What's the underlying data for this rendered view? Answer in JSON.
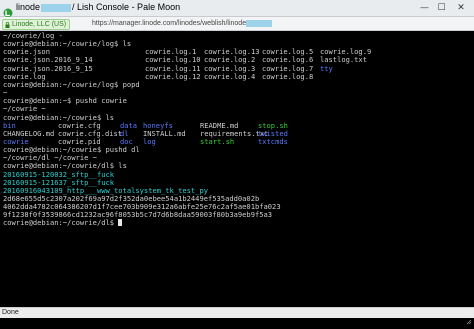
{
  "window": {
    "title_prefix": "linode",
    "title_suffix": "/ Lish Console - Pale Moon",
    "minimize_glyph": "—",
    "maximize_glyph": "☐",
    "close_glyph": "✕"
  },
  "urlbar": {
    "site_label": "Linode, LLC (US)",
    "url_prefix": "https://manager.linode.com/linodes/weblish/linode"
  },
  "terminal": {
    "lines": [
      {
        "spans": [
          {
            "text": "~/cowrie/log -",
            "color": "grey"
          }
        ]
      },
      {
        "spans": [
          {
            "text": "cowrie@debian:~/cowrie/log$ ls",
            "color": "grey"
          }
        ]
      },
      {
        "cols": [
          [
            "cowrie.json",
            "grey"
          ],
          [
            "cowrie.log.1",
            "grey"
          ],
          [
            "cowrie.log.13",
            "grey"
          ],
          [
            "cowrie.log.5",
            "grey"
          ],
          [
            "cowrie.log.9",
            "grey"
          ]
        ]
      },
      {
        "cols": [
          [
            "cowrie.json.2016_9_14",
            "grey"
          ],
          [
            "cowrie.log.10",
            "grey"
          ],
          [
            "cowrie.log.2",
            "grey"
          ],
          [
            "cowrie.log.6",
            "grey"
          ],
          [
            "lastlog.txt",
            "grey"
          ]
        ]
      },
      {
        "cols": [
          [
            "cowrie.json.2016_9_15",
            "grey"
          ],
          [
            "cowrie.log.11",
            "grey"
          ],
          [
            "cowrie.log.3",
            "grey"
          ],
          [
            "cowrie.log.7",
            "grey"
          ],
          [
            "tty",
            "blue"
          ]
        ]
      },
      {
        "cols": [
          [
            "cowrie.log",
            "grey"
          ],
          [
            "cowrie.log.12",
            "grey"
          ],
          [
            "cowrie.log.4",
            "grey"
          ],
          [
            "cowrie.log.8",
            "grey"
          ],
          [
            "",
            ""
          ]
        ]
      },
      {
        "spans": [
          {
            "text": "cowrie@debian:~/cowrie/log$ popd",
            "color": "grey"
          }
        ]
      },
      {
        "spans": [
          {
            "text": "~",
            "color": "grey"
          }
        ]
      },
      {
        "spans": [
          {
            "text": "cowrie@debian:~$ pushd cowrie",
            "color": "grey"
          }
        ]
      },
      {
        "spans": [
          {
            "text": "~/cowrie ~",
            "color": "grey"
          }
        ]
      },
      {
        "spans": [
          {
            "text": "cowrie@debian:~/cowrie$ ls",
            "color": "grey"
          }
        ]
      },
      {
        "cols6": [
          [
            "bin",
            "blue"
          ],
          [
            "cowrie.cfg",
            "grey"
          ],
          [
            "data",
            "blue"
          ],
          [
            "honeyfs",
            "blue"
          ],
          [
            "README.md",
            "grey"
          ],
          [
            "stop.sh",
            "green"
          ]
        ]
      },
      {
        "cols6": [
          [
            "CHANGELOG.md",
            "grey"
          ],
          [
            "cowrie.cfg.dist",
            "grey"
          ],
          [
            "dl",
            "blue"
          ],
          [
            "INSTALL.md",
            "grey"
          ],
          [
            "requirements.txt",
            "grey"
          ],
          [
            "twisted",
            "blue"
          ]
        ]
      },
      {
        "cols6": [
          [
            "cowrie",
            "blue"
          ],
          [
            "cowrie.pid",
            "grey"
          ],
          [
            "doc",
            "blue"
          ],
          [
            "log",
            "blue"
          ],
          [
            "start.sh",
            "green"
          ],
          [
            "txtcmds",
            "blue"
          ]
        ]
      },
      {
        "spans": [
          {
            "text": "cowrie@debian:~/cowrie$ pushd dl",
            "color": "grey"
          }
        ]
      },
      {
        "spans": [
          {
            "text": "~/cowrie/dl ~/cowrie ~",
            "color": "grey"
          }
        ]
      },
      {
        "spans": [
          {
            "text": "cowrie@debian:~/cowrie/dl$ ls",
            "color": "grey"
          }
        ]
      },
      {
        "spans": [
          {
            "text": "20160915-120032_sftp__fuck",
            "color": "cyan"
          }
        ]
      },
      {
        "spans": [
          {
            "text": "20160915-121637_sftp__fuck",
            "color": "cyan"
          }
        ]
      },
      {
        "spans": [
          {
            "text": "20160916043109_http___www_totalsystem_tk_test_py",
            "color": "cyan"
          }
        ]
      },
      {
        "spans": [
          {
            "text": "2d68e655d5c2307a202f69a97d2f352da0ebee54a1b2449ef535add0a02b",
            "color": "grey"
          }
        ]
      },
      {
        "spans": [
          {
            "text": "4062dda4782c064386207d1f7cee703b909e312a6abfe25e76c2af5ae01bfa023",
            "color": "grey"
          }
        ]
      },
      {
        "spans": [
          {
            "text": "9f1238f0f3539866cd1232ac96f8053b5c7d7d6b8daa59003f80b3a9eb9f5a3",
            "color": "grey"
          }
        ]
      },
      {
        "spans": [
          {
            "text": "cowrie@debian:~/cowrie/dl$ ",
            "color": "grey"
          }
        ],
        "cursor": true
      }
    ]
  },
  "statusbar": {
    "text": "Done"
  },
  "colors": {
    "dir": "#5a78ff",
    "file": "#cfcfcf",
    "exec": "#32d032",
    "download": "#2ad0d0",
    "background": "#000000"
  }
}
